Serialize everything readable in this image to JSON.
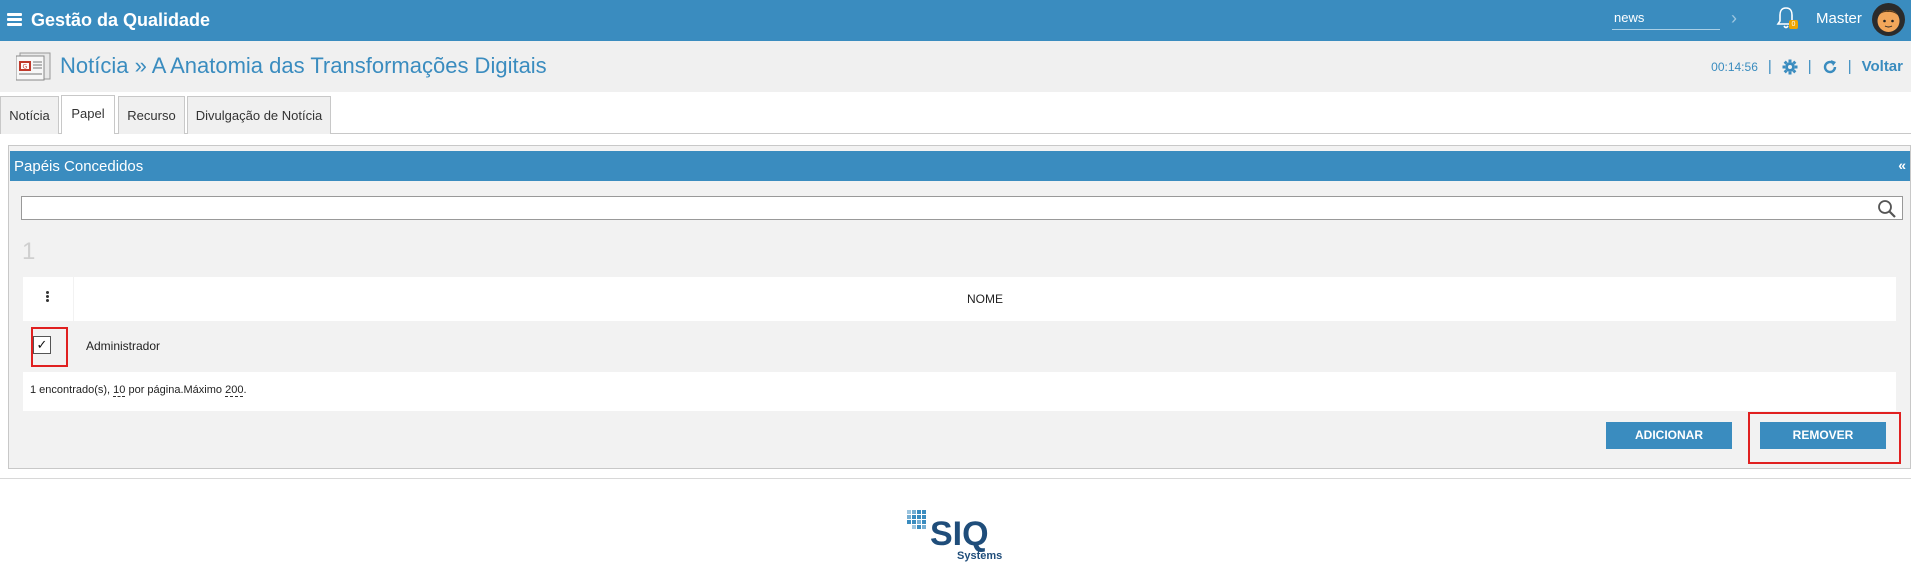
{
  "topbar": {
    "app_title": "Gestão da Qualidade",
    "search_value": "news",
    "notification_count": "0",
    "user_name": "Master"
  },
  "header": {
    "title": "Notícia » A Anatomia das Transformações Digitais",
    "time": "00:14:56",
    "back_label": "Voltar"
  },
  "tabs": [
    {
      "label": "Notícia"
    },
    {
      "label": "Papel",
      "active": true
    },
    {
      "label": "Recurso"
    },
    {
      "label": "Divulgação de Notícia"
    }
  ],
  "panel": {
    "title": "Papéis Concedidos",
    "collapse_label": "«",
    "filter_value": "",
    "selected_count": "1",
    "column_header": "NOME",
    "rows": [
      {
        "name": "Administrador",
        "checked": true,
        "check_mark": "✓"
      }
    ],
    "footer": {
      "found_text": "1 encontrado(s), ",
      "per_page": "10",
      "per_page_text": " por página.Máximo ",
      "max": "200",
      "end": "."
    },
    "buttons": {
      "add_label": "ADICIONAR",
      "remove_label": "REMOVER"
    }
  },
  "footer_logo": {
    "brand": "SIQ",
    "subtitle": "Systems"
  },
  "colors": {
    "primary": "#3a8cbf",
    "highlight": "#e02020"
  }
}
